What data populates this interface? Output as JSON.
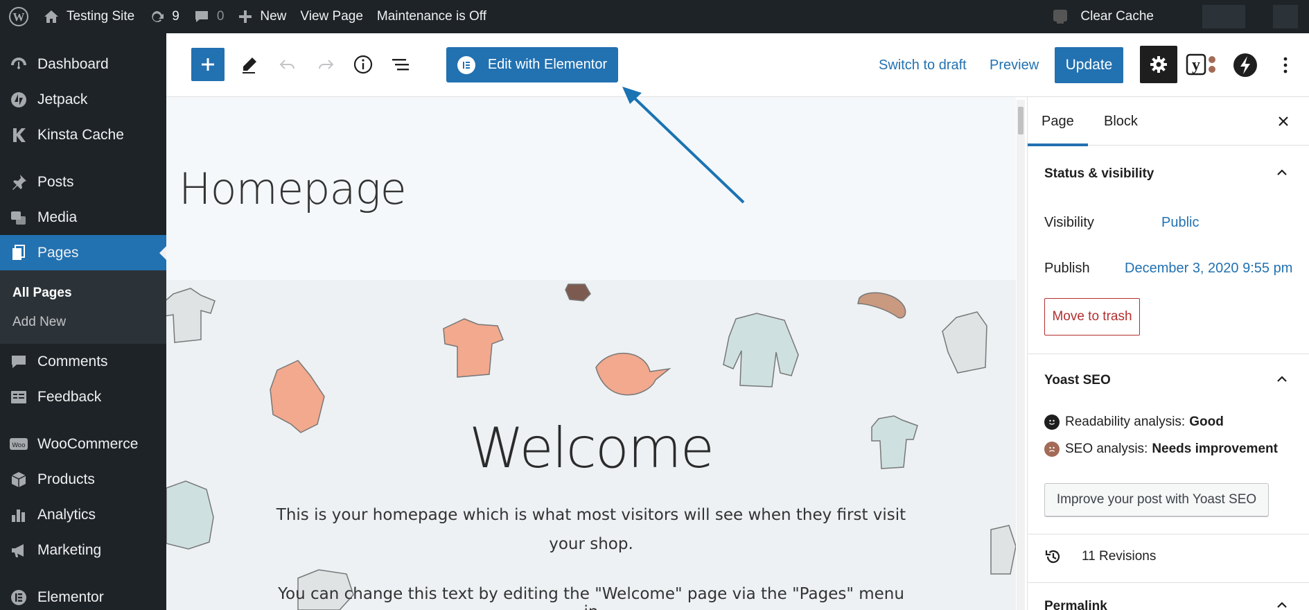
{
  "adminbar": {
    "site_name": "Testing Site",
    "updates_count": "9",
    "comments_count": "0",
    "new_label": "New",
    "view_page": "View Page",
    "maintenance": "Maintenance is Off",
    "clear_cache": "Clear Cache"
  },
  "sidebar": {
    "items": [
      {
        "label": "Dashboard",
        "icon": "dashboard-icon"
      },
      {
        "label": "Jetpack",
        "icon": "jetpack-icon"
      },
      {
        "label": "Kinsta Cache",
        "icon": "kinsta-icon"
      },
      {
        "label": "Posts",
        "icon": "pin-icon"
      },
      {
        "label": "Media",
        "icon": "media-icon"
      },
      {
        "label": "Pages",
        "icon": "pages-icon"
      },
      {
        "label": "Comments",
        "icon": "comment-icon"
      },
      {
        "label": "Feedback",
        "icon": "feedback-icon"
      },
      {
        "label": "WooCommerce",
        "icon": "woo-icon"
      },
      {
        "label": "Products",
        "icon": "products-icon"
      },
      {
        "label": "Analytics",
        "icon": "analytics-icon"
      },
      {
        "label": "Marketing",
        "icon": "megaphone-icon"
      },
      {
        "label": "Elementor",
        "icon": "elementor-icon"
      }
    ],
    "submenu": {
      "all_pages": "All Pages",
      "add_new": "Add New"
    }
  },
  "header": {
    "edit_elementor": "Edit with Elementor",
    "switch_draft": "Switch to draft",
    "preview": "Preview",
    "update": "Update"
  },
  "canvas": {
    "page_title": "Homepage",
    "welcome": "Welcome",
    "intro": "This is your homepage which is what most visitors will see when they first visit your shop.",
    "intro2": "You can change this text by editing the \"Welcome\" page via the \"Pages\" menu in"
  },
  "settings": {
    "tab_page": "Page",
    "tab_block": "Block",
    "status_title": "Status & visibility",
    "visibility_label": "Visibility",
    "visibility_value": "Public",
    "publish_label": "Publish",
    "publish_value": "December 3, 2020 9:55 pm",
    "move_trash": "Move to trash",
    "yoast_title": "Yoast SEO",
    "readability_label": "Readability analysis:",
    "readability_value": "Good",
    "seo_label": "SEO analysis:",
    "seo_value": "Needs improvement",
    "improve_btn": "Improve your post with Yoast SEO",
    "revisions": "11 Revisions",
    "permalink": "Permalink"
  },
  "colors": {
    "accent": "#2271b1",
    "admin_bg": "#1d2327",
    "trash": "#b32d2e"
  }
}
